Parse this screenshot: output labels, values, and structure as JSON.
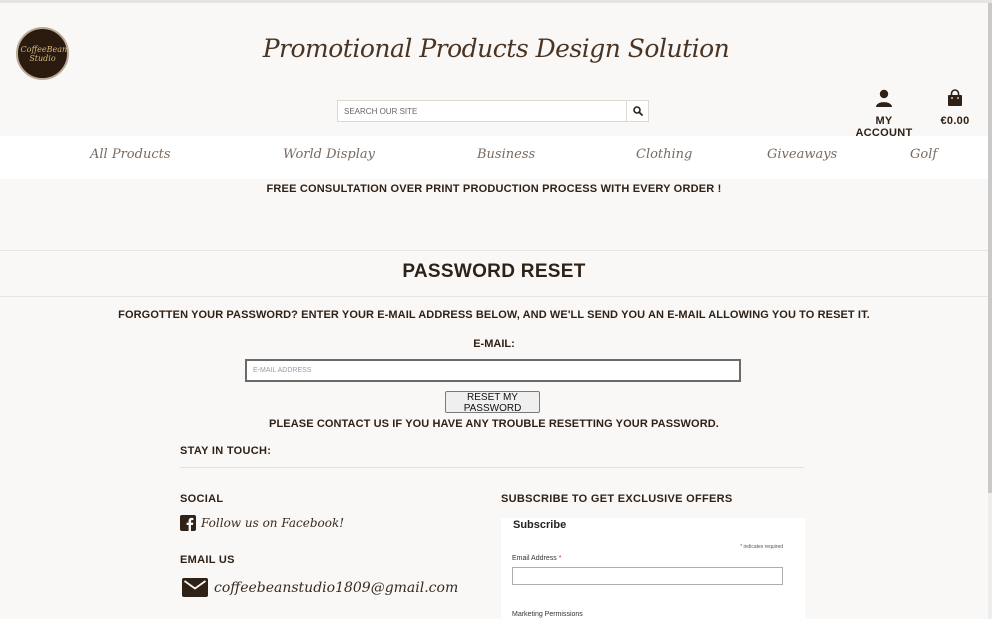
{
  "header": {
    "logo_text": "CoffeeBean Studio",
    "site_title": "Promotional Products Design Solution",
    "search_placeholder": "SEARCH OUR SITE",
    "account_label": "MY ACCOUNT",
    "cart_total": "€0.00"
  },
  "nav": {
    "items": [
      {
        "label": "All Products"
      },
      {
        "label": "World Display"
      },
      {
        "label": "Business"
      },
      {
        "label": "Clothing"
      },
      {
        "label": "Giveaways"
      },
      {
        "label": "Golf"
      }
    ]
  },
  "promo_banner": "FREE CONSULTATION OVER PRINT PRODUCTION PROCESS WITH EVERY ORDER !",
  "reset": {
    "title": "PASSWORD RESET",
    "instructions": "FORGOTTEN YOUR PASSWORD? ENTER YOUR E-MAIL ADDRESS BELOW, AND WE'LL SEND YOU AN E-MAIL ALLOWING YOU TO RESET IT.",
    "email_label": "E-MAIL:",
    "email_placeholder": "E-MAIL ADDRESS",
    "button_label": "RESET MY PASSWORD",
    "contact_note": "PLEASE CONTACT US IF YOU HAVE ANY TROUBLE RESETTING YOUR PASSWORD."
  },
  "footer": {
    "stay_in_touch": "STAY IN TOUCH:",
    "social_heading": "SOCIAL",
    "facebook_text": "Follow us on Facebook!",
    "email_heading": "EMAIL US",
    "email_address": "coffeebeanstudio1809@gmail.com",
    "subscribe_heading": "SUBSCRIBE TO GET EXCLUSIVE OFFERS",
    "subscribe_form": {
      "title": "Subscribe",
      "required_note": "indicates required",
      "email_label": "Email Address",
      "marketing_label": "Marketing Permissions"
    }
  },
  "colors": {
    "background": "#faf8f6",
    "text_dark": "#2f2116",
    "nav_text": "#7a6a5e",
    "logo_bg": "#2a1a10"
  }
}
